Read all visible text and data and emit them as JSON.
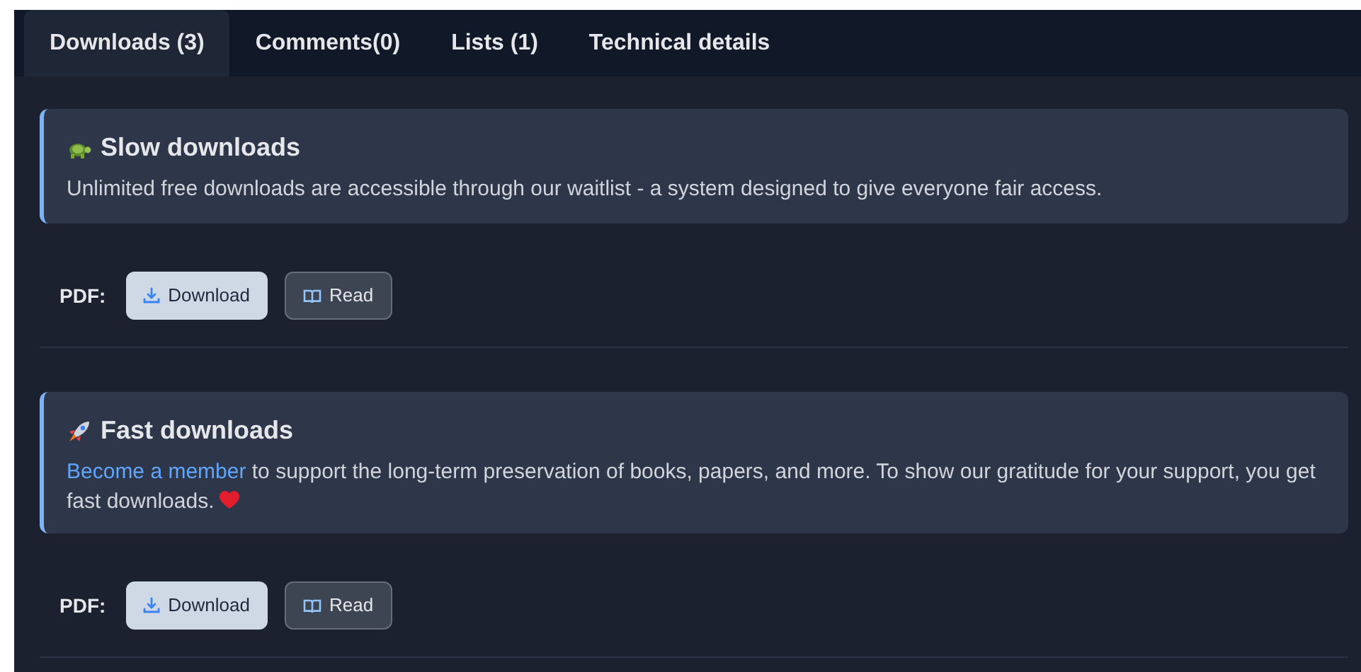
{
  "tabs": [
    {
      "label": "Downloads (3)",
      "selected": true
    },
    {
      "label": "Comments(0)",
      "selected": false
    },
    {
      "label": "Lists (1)",
      "selected": false
    },
    {
      "label": "Technical details",
      "selected": false
    }
  ],
  "sections": [
    {
      "kind": "slow",
      "title": "Slow downloads",
      "text": "Unlimited free downloads are accessible through our waitlist - a system designed to give everyone fair access.",
      "heart": false,
      "format": "PDF:",
      "buttons": [
        {
          "kind": "download",
          "label": "Download"
        },
        {
          "kind": "read",
          "label": "Read"
        }
      ]
    },
    {
      "kind": "fast",
      "title": "Fast downloads",
      "link": "Become a member",
      "text": " to support the long-term preservation of books, papers, and more. To show our gratitude for your support, you get fast downloads.",
      "heart": true,
      "format": "PDF:",
      "buttons": [
        {
          "kind": "download",
          "label": "Download"
        },
        {
          "kind": "read",
          "label": "Read"
        }
      ]
    }
  ]
}
